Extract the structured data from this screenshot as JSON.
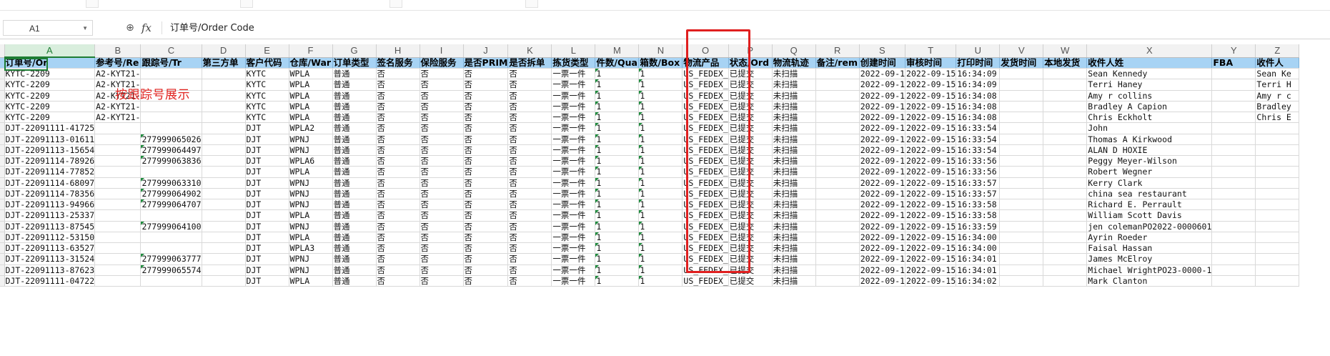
{
  "name_box": "A1",
  "formula_bar": {
    "content": "订单号/Order Code"
  },
  "annotation": "按跟踪号展示",
  "columns": [
    "A",
    "B",
    "C",
    "D",
    "E",
    "F",
    "G",
    "H",
    "I",
    "J",
    "K",
    "L",
    "M",
    "N",
    "O",
    "P",
    "Q",
    "R",
    "S",
    "T",
    "U",
    "V",
    "W",
    "X",
    "Y",
    "Z"
  ],
  "active_column": "A",
  "header_row": [
    "订单号/Or",
    "参考号/Re",
    "跟踪号/Tr",
    "第三方单",
    "客户代码",
    "仓库/War",
    "订单类型",
    "签名服务",
    "保险服务",
    "是否PRIM",
    "是否拆单",
    "拣货类型",
    "件数/Qua",
    "箱数/Box",
    "物流产品",
    "状态/Ord",
    "物流轨迹",
    "备注/rem",
    "创建时间",
    "审核时间",
    "打印时间",
    "发货时间",
    "本地发货",
    "收件人姓",
    "FBA",
    "收件人"
  ],
  "rows": [
    [
      "KYTC-2209",
      "A2-KYT21-",
      "",
      "",
      "KYTC",
      "WPLA",
      "普通",
      "否",
      "否",
      "否",
      "否",
      "一票一件",
      "1",
      "1",
      "US_FEDEX_",
      "已提交",
      "未扫描",
      "",
      "2022-09-1",
      "2022-09-15",
      "16:34:09",
      "",
      "",
      "Sean Kennedy",
      "",
      "Sean Ke"
    ],
    [
      "KYTC-2209",
      "A2-KYT21-",
      "",
      "",
      "KYTC",
      "WPLA",
      "普通",
      "否",
      "否",
      "否",
      "否",
      "一票一件",
      "1",
      "1",
      "US_FEDEX_",
      "已提交",
      "未扫描",
      "",
      "2022-09-1",
      "2022-09-15",
      "16:34:09",
      "",
      "",
      "Terri Haney",
      "",
      "Terri H"
    ],
    [
      "KYTC-2209",
      "A2-KYT21-",
      "",
      "",
      "KYTC",
      "WPLA",
      "普通",
      "否",
      "否",
      "否",
      "否",
      "一票一件",
      "1",
      "1",
      "US_FEDEX_",
      "已提交",
      "未扫描",
      "",
      "2022-09-1",
      "2022-09-15",
      "16:34:08",
      "",
      "",
      "Amy r collins",
      "",
      "Amy r c"
    ],
    [
      "KYTC-2209",
      "A2-KYT21-",
      "",
      "",
      "KYTC",
      "WPLA",
      "普通",
      "否",
      "否",
      "否",
      "否",
      "一票一件",
      "1",
      "1",
      "US_FEDEX_",
      "已提交",
      "未扫描",
      "",
      "2022-09-1",
      "2022-09-15",
      "16:34:08",
      "",
      "",
      "Bradley A Capion",
      "",
      "Bradley"
    ],
    [
      "KYTC-2209",
      "A2-KYT21-",
      "",
      "",
      "KYTC",
      "WPLA",
      "普通",
      "否",
      "否",
      "否",
      "否",
      "一票一件",
      "1",
      "1",
      "US_FEDEX_",
      "已提交",
      "未扫描",
      "",
      "2022-09-1",
      "2022-09-15",
      "16:34:08",
      "",
      "",
      "Chris Eckholt",
      "",
      "Chris E"
    ],
    [
      "DJT-22091111-41725",
      "",
      "",
      "",
      "DJT",
      "WPLA2",
      "普通",
      "否",
      "否",
      "否",
      "否",
      "一票一件",
      "1",
      "1",
      "US_FEDEX_",
      "已提交",
      "未扫描",
      "",
      "2022-09-1",
      "2022-09-15",
      "16:33:54",
      "",
      "",
      "John",
      "",
      ""
    ],
    [
      "DJT-22091113-01611",
      "",
      "277999065026",
      "",
      "DJT",
      "WPNJ",
      "普通",
      "否",
      "否",
      "否",
      "否",
      "一票一件",
      "1",
      "1",
      "US_FEDEX_",
      "已提交",
      "未扫描",
      "",
      "2022-09-1",
      "2022-09-15",
      "16:33:54",
      "",
      "",
      "Thomas A Kirkwood",
      "",
      ""
    ],
    [
      "DJT-22091113-15654",
      "",
      "277999064497",
      "",
      "DJT",
      "WPNJ",
      "普通",
      "否",
      "否",
      "否",
      "否",
      "一票一件",
      "1",
      "1",
      "US_FEDEX_",
      "已提交",
      "未扫描",
      "",
      "2022-09-1",
      "2022-09-15",
      "16:33:54",
      "",
      "",
      "ALAN D HOXIE",
      "",
      ""
    ],
    [
      "DJT-22091114-78926",
      "",
      "277999063836",
      "",
      "DJT",
      "WPLA6",
      "普通",
      "否",
      "否",
      "否",
      "否",
      "一票一件",
      "1",
      "1",
      "US_FEDEX_",
      "已提交",
      "未扫描",
      "",
      "2022-09-1",
      "2022-09-15",
      "16:33:56",
      "",
      "",
      "Peggy Meyer-Wilson",
      "",
      ""
    ],
    [
      "DJT-22091114-77852",
      "",
      "",
      "",
      "DJT",
      "WPLA",
      "普通",
      "否",
      "否",
      "否",
      "否",
      "一票一件",
      "1",
      "1",
      "US_FEDEX_",
      "已提交",
      "未扫描",
      "",
      "2022-09-1",
      "2022-09-15",
      "16:33:56",
      "",
      "",
      "Robert Wegner",
      "",
      ""
    ],
    [
      "DJT-22091114-68097",
      "",
      "277999063310",
      "",
      "DJT",
      "WPNJ",
      "普通",
      "否",
      "否",
      "否",
      "否",
      "一票一件",
      "1",
      "1",
      "US_FEDEX_",
      "已提交",
      "未扫描",
      "",
      "2022-09-1",
      "2022-09-15",
      "16:33:57",
      "",
      "",
      "Kerry Clark",
      "",
      ""
    ],
    [
      "DJT-22091114-78356",
      "",
      "277999064902",
      "",
      "DJT",
      "WPNJ",
      "普通",
      "否",
      "否",
      "否",
      "否",
      "一票一件",
      "1",
      "1",
      "US_FEDEX_",
      "已提交",
      "未扫描",
      "",
      "2022-09-1",
      "2022-09-15",
      "16:33:57",
      "",
      "",
      "china sea restaurant",
      "",
      ""
    ],
    [
      "DJT-22091113-94966",
      "",
      "277999064707",
      "",
      "DJT",
      "WPNJ",
      "普通",
      "否",
      "否",
      "否",
      "否",
      "一票一件",
      "1",
      "1",
      "US_FEDEX_",
      "已提交",
      "未扫描",
      "",
      "2022-09-1",
      "2022-09-15",
      "16:33:58",
      "",
      "",
      "Richard E. Perrault",
      "",
      ""
    ],
    [
      "DJT-22091113-25337",
      "",
      "",
      "",
      "DJT",
      "WPLA",
      "普通",
      "否",
      "否",
      "否",
      "否",
      "一票一件",
      "1",
      "1",
      "US_FEDEX_",
      "已提交",
      "未扫描",
      "",
      "2022-09-1",
      "2022-09-15",
      "16:33:58",
      "",
      "",
      "William Scott Davis",
      "",
      ""
    ],
    [
      "DJT-22091113-87545",
      "",
      "277999064100",
      "",
      "DJT",
      "WPNJ",
      "普通",
      "否",
      "否",
      "否",
      "否",
      "一票一件",
      "1",
      "1",
      "US_FEDEX_",
      "已提交",
      "未扫描",
      "",
      "2022-09-1",
      "2022-09-15",
      "16:33:59",
      "",
      "",
      "jen colemanPO2022-0000601",
      "",
      ""
    ],
    [
      "DJT-22091112-53150",
      "",
      "",
      "",
      "DJT",
      "WPLA",
      "普通",
      "否",
      "否",
      "否",
      "否",
      "一票一件",
      "1",
      "1",
      "US_FEDEX_",
      "已提交",
      "未扫描",
      "",
      "2022-09-1",
      "2022-09-15",
      "16:34:00",
      "",
      "",
      "Ayrin Roeder",
      "",
      ""
    ],
    [
      "DJT-22091113-63527",
      "",
      "",
      "",
      "DJT",
      "WPLA3",
      "普通",
      "否",
      "否",
      "否",
      "否",
      "一票一件",
      "1",
      "1",
      "US_FEDEX_",
      "已提交",
      "未扫描",
      "",
      "2022-09-1",
      "2022-09-15",
      "16:34:00",
      "",
      "",
      "Faisal Hassan",
      "",
      ""
    ],
    [
      "DJT-22091113-31524",
      "",
      "277999063777",
      "",
      "DJT",
      "WPNJ",
      "普通",
      "否",
      "否",
      "否",
      "否",
      "一票一件",
      "1",
      "1",
      "US_FEDEX_",
      "已提交",
      "未扫描",
      "",
      "2022-09-1",
      "2022-09-15",
      "16:34:01",
      "",
      "",
      "James McElroy",
      "",
      ""
    ],
    [
      "DJT-22091113-87623",
      "",
      "277999065574",
      "",
      "DJT",
      "WPNJ",
      "普通",
      "否",
      "否",
      "否",
      "否",
      "一票一件",
      "1",
      "1",
      "US_FEDEX_",
      "已提交",
      "未扫描",
      "",
      "2022-09-1",
      "2022-09-15",
      "16:34:01",
      "",
      "",
      "Michael WrightPO23-0000-1",
      "",
      ""
    ],
    [
      "DJT-22091111-04722",
      "",
      "",
      "",
      "DJT",
      "WPLA",
      "普通",
      "否",
      "否",
      "否",
      "否",
      "一票一件",
      "1",
      "1",
      "US_FEDEX_",
      "已提交",
      "未扫描",
      "",
      "2022-09-1",
      "2022-09-15",
      "16:34:02",
      "",
      "",
      "Mark Clanton",
      "",
      ""
    ]
  ],
  "colors": {
    "header_fill": "#a7d3f4",
    "highlight_box": "#e01f1f",
    "active_cell": "#1e7d34",
    "annotation": "#e0231f"
  }
}
